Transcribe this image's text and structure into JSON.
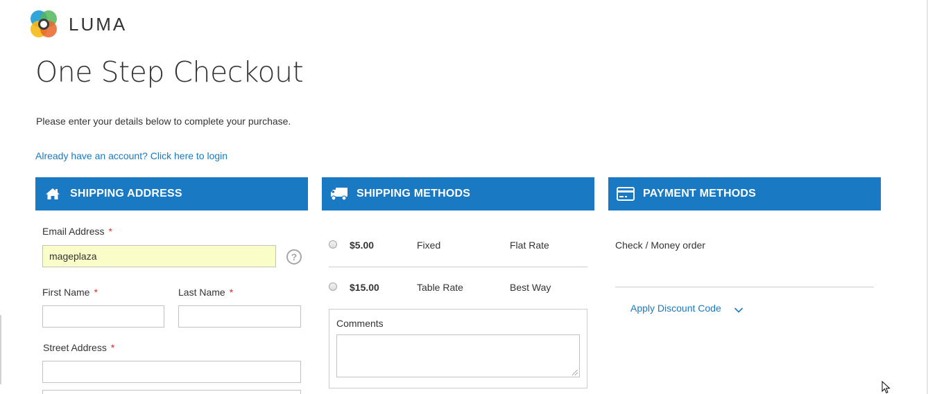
{
  "logo": {
    "text": "LUMA",
    "icon": "luma-logo-icon"
  },
  "page": {
    "title": "One Step Checkout",
    "subtitle": "Please enter your details below to complete your purchase.",
    "login_link": "Already have an account? Click here to login"
  },
  "shipping_address": {
    "title": "SHIPPING ADDRESS",
    "icon": "home-icon",
    "email_label": "Email Address",
    "email_value": "mageplaza",
    "first_name_label": "First Name",
    "last_name_label": "Last Name",
    "street_label": "Street Address",
    "required_mark": "*"
  },
  "shipping_methods": {
    "title": "SHIPPING METHODS",
    "icon": "truck-icon",
    "options": [
      {
        "price": "$5.00",
        "method": "Fixed",
        "carrier": "Flat Rate"
      },
      {
        "price": "$15.00",
        "method": "Table Rate",
        "carrier": "Best Way"
      }
    ],
    "comments_label": "Comments"
  },
  "payment_methods": {
    "title": "PAYMENT METHODS",
    "icon": "credit-card-icon",
    "option": "Check / Money order",
    "discount_link": "Apply Discount Code"
  },
  "colors": {
    "accent": "#1979c3",
    "autofill": "#fafdc8",
    "required": "#e02b27"
  }
}
